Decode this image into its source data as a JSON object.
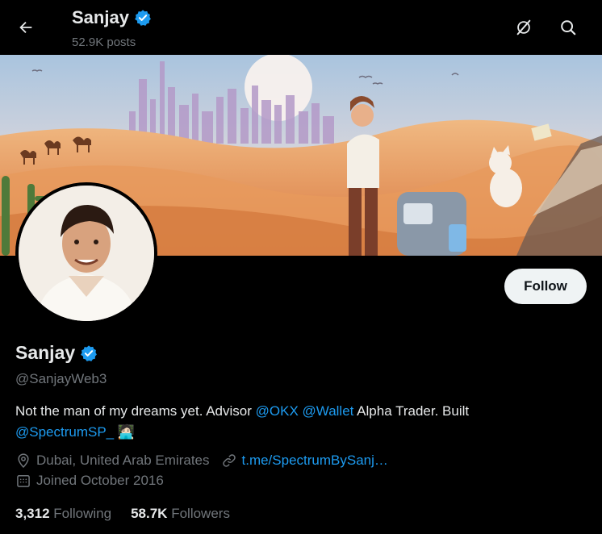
{
  "header": {
    "name": "Sanjay",
    "posts": "52.9K posts",
    "icons": [
      "back-arrow-icon",
      "grok-icon",
      "search-icon"
    ]
  },
  "profile": {
    "name": "Sanjay",
    "handle": "@SanjayWeb3",
    "verified": true,
    "follow_label": "Follow",
    "bio": {
      "text1": "Not the man of my dreams yet. Advisor ",
      "mention1": "@OKX",
      "mention2": "@Wallet",
      "text2": " Alpha Trader. Built",
      "mention3": "@SpectrumSP_",
      "emoji": "🧑🏻‍💻"
    },
    "location": "Dubai, United Arab Emirates",
    "link": "t.me/SpectrumBySanj…",
    "joined": "Joined October 2016",
    "following_count": "3,312",
    "following_label": "Following",
    "followers_count": "58.7K",
    "followers_label": "Followers"
  },
  "colors": {
    "background": "#000000",
    "text": "#e7e9ea",
    "muted": "#71767b",
    "accent": "#1d9bf0",
    "button_bg": "#eff3f4"
  }
}
